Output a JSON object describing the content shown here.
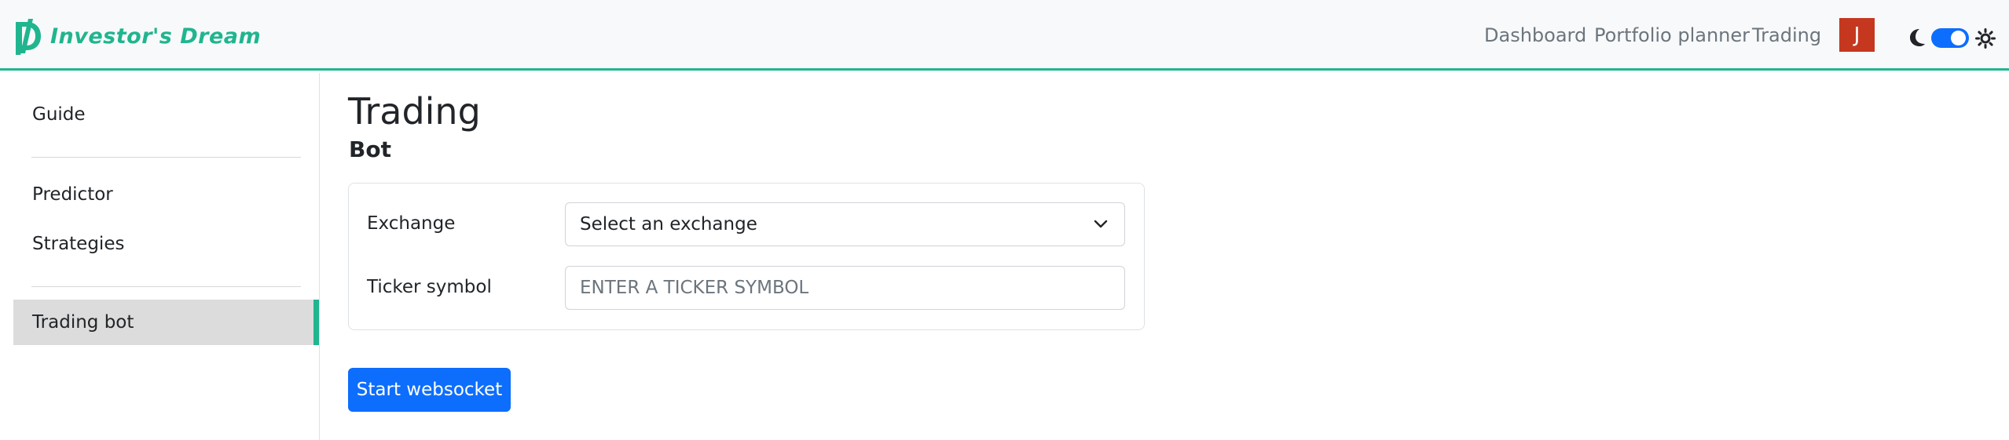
{
  "brand": {
    "name": "Investor's Dream",
    "color": "#20b58f"
  },
  "nav": {
    "links": [
      "Dashboard",
      "Portfolio planner",
      "Trading"
    ],
    "avatar_letter": "J",
    "avatar_color": "#c5381f",
    "theme_toggle_on": true
  },
  "sidebar": {
    "items": [
      {
        "label": "Guide",
        "active": false
      },
      {
        "label": "Predictor",
        "active": false
      },
      {
        "label": "Strategies",
        "active": false
      },
      {
        "label": "Trading bot",
        "active": true
      }
    ]
  },
  "page": {
    "title": "Trading",
    "section": "Bot"
  },
  "form": {
    "exchange_label": "Exchange",
    "exchange_value": "Select an exchange",
    "ticker_label": "Ticker symbol",
    "ticker_placeholder": "ENTER A TICKER SYMBOL",
    "ticker_value": ""
  },
  "actions": {
    "start_label": "Start websocket",
    "primary_color": "#0d6efd"
  }
}
